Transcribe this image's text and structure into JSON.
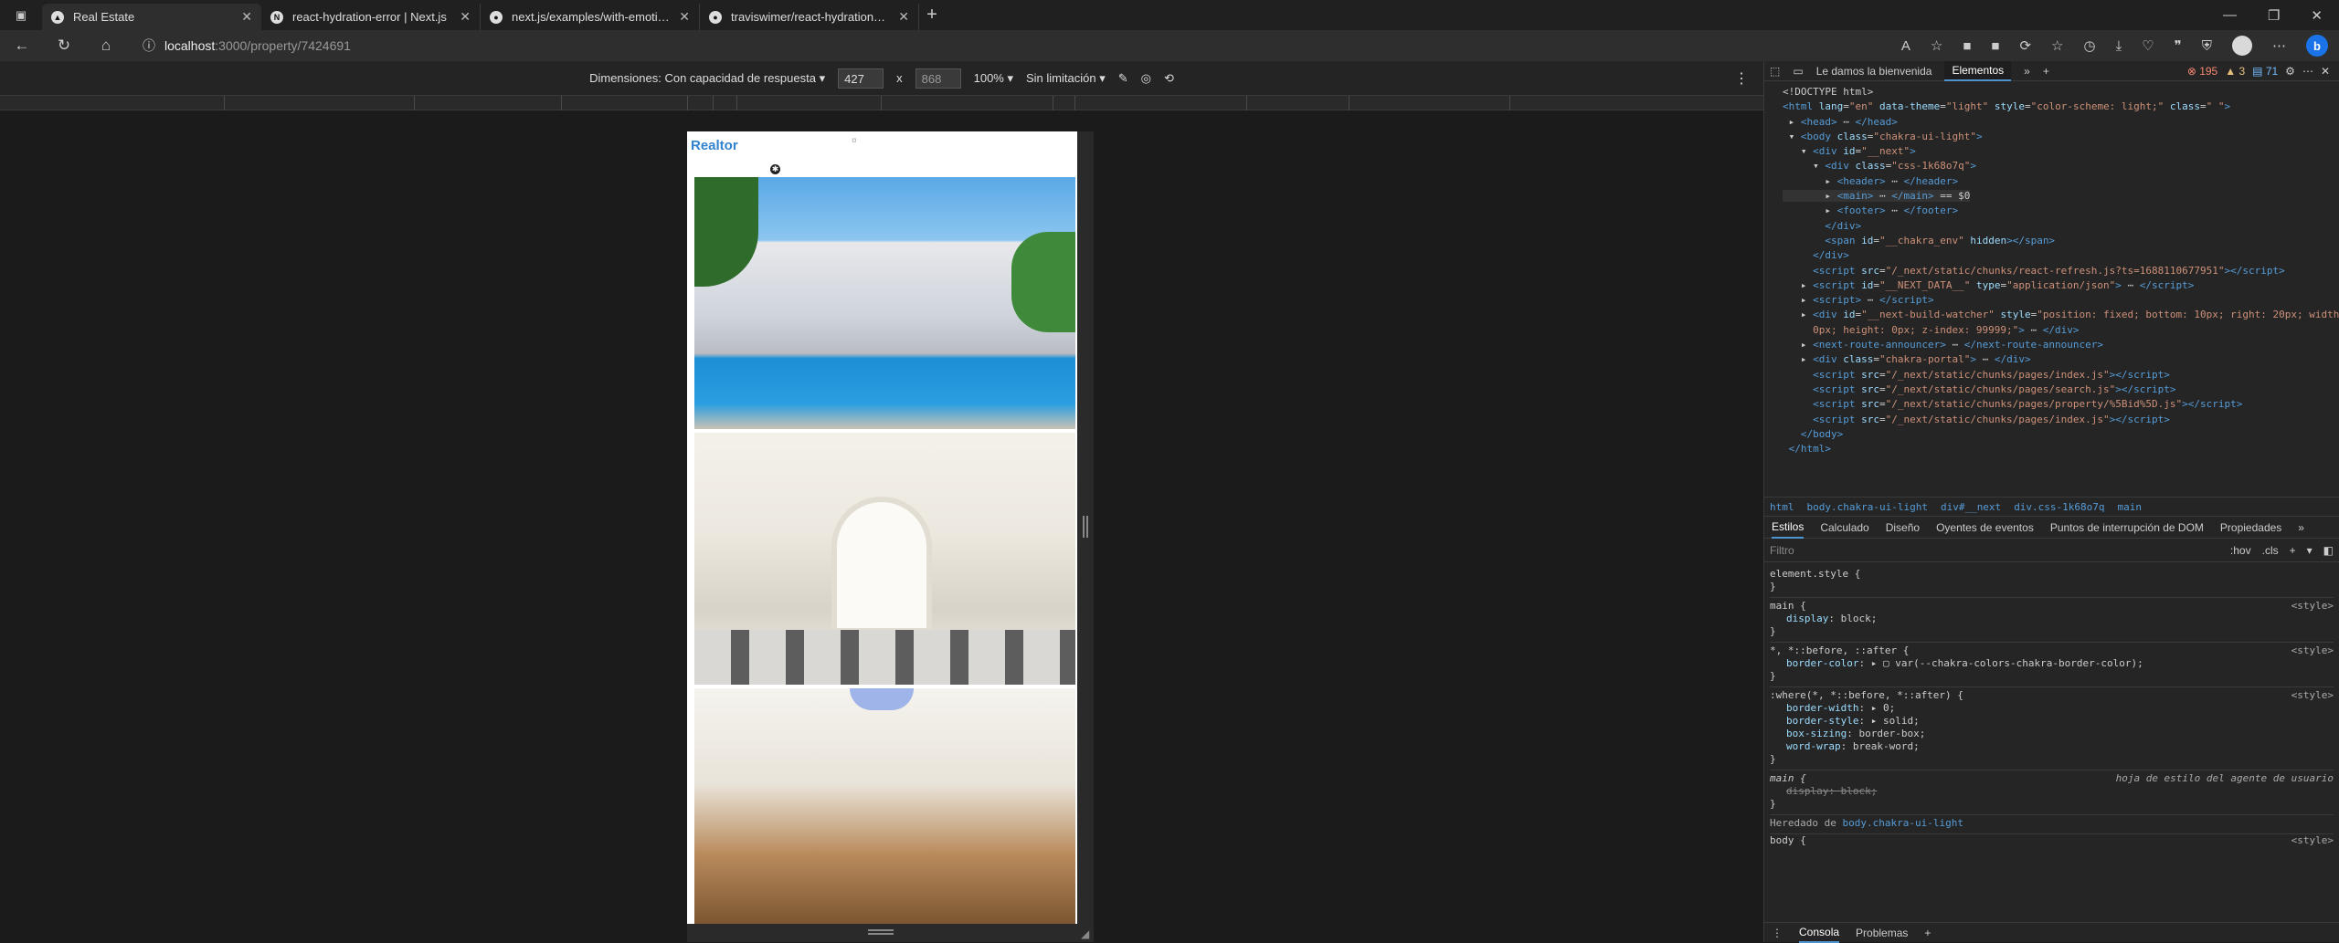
{
  "tabs": [
    {
      "title": "Real Estate",
      "active": true
    },
    {
      "title": "react-hydration-error | Next.js"
    },
    {
      "title": "next.js/examples/with-emotion a"
    },
    {
      "title": "traviswimer/react-hydration-pro"
    }
  ],
  "address": {
    "host": "localhost",
    "path": ":3000/property/7424691"
  },
  "device": {
    "dimensions_label": "Dimensiones: Con capacidad de respuesta",
    "width": "427",
    "height": "868",
    "times": "x",
    "zoom": "100%",
    "throttle": "Sin limitación"
  },
  "page": {
    "brand": "Realtor",
    "dot": "¤",
    "menu": "✱"
  },
  "devtools": {
    "tabs": [
      "Le damos la bienvenida",
      "Elementos"
    ],
    "errors": "195",
    "warnings": "3",
    "infos": "71",
    "breadcrumbs": [
      "html",
      "body.chakra-ui-light",
      "div#__next",
      "div.css-1k68o7q",
      "main"
    ],
    "subtabs": [
      "Estilos",
      "Calculado",
      "Diseño",
      "Oyentes de eventos",
      "Puntos de interrupción de DOM",
      "Propiedades"
    ],
    "filter": "Filtro",
    "hov": ":hov",
    "cls": ".cls",
    "inherited_label": "Heredado de",
    "inherited_from": "body.chakra-ui-light",
    "ua_label": "hoja de estilo del agente de usuario",
    "console_tabs": [
      "Consola",
      "Problemas"
    ]
  }
}
